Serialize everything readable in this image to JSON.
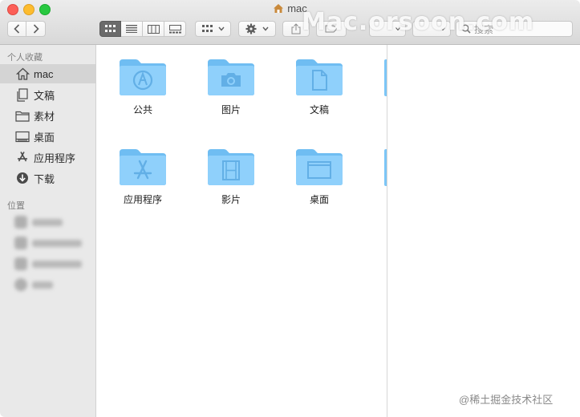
{
  "window": {
    "title": "mac"
  },
  "toolbar": {
    "back_icon": "chevron-left-icon",
    "forward_icon": "chevron-right-icon",
    "view_modes": [
      "icon-view",
      "list-view",
      "column-view",
      "gallery-view"
    ],
    "active_view": "icon-view",
    "search_placeholder": "搜索"
  },
  "watermark": "Mac.orsoon.com",
  "sidebar": {
    "favorites_header": "个人收藏",
    "favorites": [
      {
        "label": "mac",
        "icon": "home-icon",
        "selected": true
      },
      {
        "label": "文稿",
        "icon": "document-icon",
        "selected": false
      },
      {
        "label": "素材",
        "icon": "folder-icon",
        "selected": false
      },
      {
        "label": "桌面",
        "icon": "desktop-icon",
        "selected": false
      },
      {
        "label": "应用程序",
        "icon": "applications-icon",
        "selected": false
      },
      {
        "label": "下载",
        "icon": "download-icon",
        "selected": false
      }
    ],
    "locations_header": "位置"
  },
  "content": {
    "folders": [
      {
        "label": "公共",
        "emblem": "public-icon"
      },
      {
        "label": "图片",
        "emblem": "camera-icon"
      },
      {
        "label": "文稿",
        "emblem": "document-icon"
      },
      {
        "label": "应用程序",
        "emblem": "app-store-icon"
      },
      {
        "label": "影片",
        "emblem": "film-icon"
      },
      {
        "label": "桌面",
        "emblem": "desktop-icon"
      }
    ]
  },
  "credit": "@稀土掘金技术社区",
  "colors": {
    "folder_body": "#8fd0fb",
    "folder_tab": "#6fbdf2",
    "sidebar_bg": "#e9e9e9"
  }
}
